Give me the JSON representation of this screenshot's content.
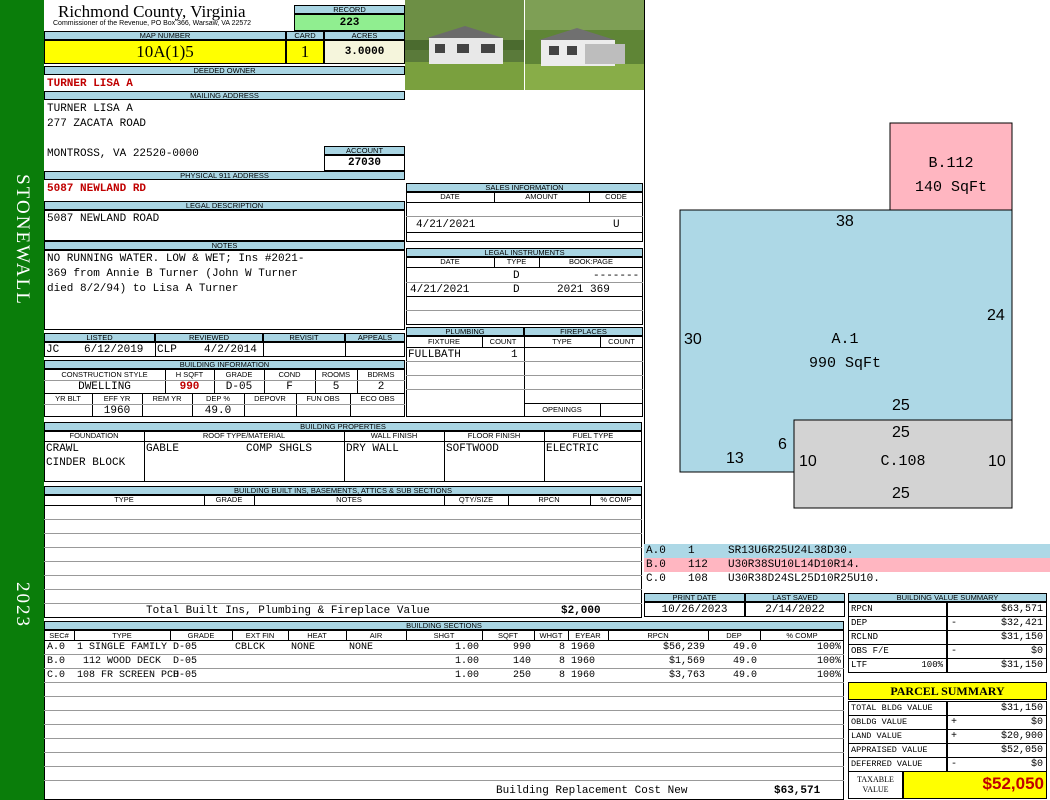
{
  "header": {
    "county": "Richmond County, Virginia",
    "commissioner": "Commissioner of the Revenue, PO Box 366, Warsaw, VA 22572",
    "record_label": "RECORD",
    "record": "223",
    "map_label": "MAP NUMBER",
    "map": "10A(1)5",
    "card_label": "CARD",
    "card": "1",
    "acres_label": "ACRES",
    "acres": "3.0000"
  },
  "sidebar": {
    "district": "STONEWALL",
    "year": "2023",
    "color": "#0a7d0a"
  },
  "owner": {
    "deeded_label": "DEEDED OWNER",
    "deeded": "TURNER LISA A",
    "mailing_label": "MAILING ADDRESS",
    "mail1": "TURNER LISA A",
    "mail2": "277 ZACATA ROAD",
    "mail3": "MONTROSS, VA 22520-0000",
    "account_label": "ACCOUNT",
    "account": "27030",
    "phys_label": "PHYSICAL 911 ADDRESS",
    "phys": "5087 NEWLAND RD",
    "legal_label": "LEGAL DESCRIPTION",
    "legal": "5087 NEWLAND ROAD",
    "notes_label": "NOTES",
    "notes1": "NO RUNNING WATER. LOW & WET; Ins #2021-",
    "notes2": "369 from Annie B Turner (John W Turner",
    "notes3": "died 8/2/94) to Lisa A Turner"
  },
  "sales": {
    "title": "SALES INFORMATION",
    "h_date": "DATE",
    "h_amount": "AMOUNT",
    "h_code": "CODE",
    "date": "4/21/2021",
    "code": "U"
  },
  "legal_instr": {
    "title": "LEGAL INSTRUMENTS",
    "h_date": "DATE",
    "h_type": "TYPE",
    "h_book": "BOOK:PAGE",
    "r1_type": "D",
    "r1_book": "-------",
    "r2_date": "4/21/2021",
    "r2_type": "D",
    "r2_book": "2021 369"
  },
  "review": {
    "h_listed": "LISTED",
    "h_reviewed": "REVIEWED",
    "h_revisit": "REVISIT",
    "h_appeals": "APPEALS",
    "listed_by": "JC",
    "listed_date": "6/12/2019",
    "rev_by": "CLP",
    "rev_date": "4/2/2014"
  },
  "building_info": {
    "title": "BUILDING INFORMATION",
    "h_style": "CONSTRUCTION STYLE",
    "h_hsqft": "H SQFT",
    "h_grade": "GRADE",
    "h_cond": "COND",
    "h_rooms": "ROOMS",
    "h_bdrms": "BDRMS",
    "style": "DWELLING",
    "hsqft": "990",
    "grade": "D-05",
    "cond": "F",
    "rooms": "5",
    "bdrms": "2",
    "h_yrblt": "YR BLT",
    "h_effyr": "EFF YR",
    "h_remyr": "REM YR",
    "h_dep": "DEP %",
    "h_depovr": "DEPOVR",
    "h_funobs": "FUN OBS",
    "h_ecoobs": "ECO OBS",
    "effyr": "1960",
    "dep": "49.0"
  },
  "plumbing": {
    "title": "PLUMBING",
    "h_fixture": "FIXTURE",
    "h_count": "COUNT",
    "fixture": "FULLBATH",
    "count": "1"
  },
  "fireplaces": {
    "title": "FIREPLACES",
    "h_type": "TYPE",
    "h_count": "COUNT",
    "openings": "OPENINGS"
  },
  "props": {
    "title": "BUILDING PROPERTIES",
    "h_found": "FOUNDATION",
    "h_roof": "ROOF TYPE/MATERIAL",
    "h_wall": "WALL FINISH",
    "h_floor": "FLOOR FINISH",
    "h_fuel": "FUEL TYPE",
    "found1": "CRAWL",
    "found2": "CINDER BLOCK",
    "roof1": "GABLE",
    "roof2": "COMP SHGLS",
    "wall": "DRY WALL",
    "floor": "SOFTWOOD",
    "fuel": "ELECTRIC"
  },
  "builtins": {
    "title": "BUILDING BUILT INS, BASEMENTS, ATTICS & SUB SECTIONS",
    "h_type": "TYPE",
    "h_grade": "GRADE",
    "h_notes": "NOTES",
    "h_qty": "QTY/SIZE",
    "h_rpcn": "RPCN",
    "h_comp": "% COMP",
    "total_label": "Total Built Ins, Plumbing & Fireplace Value",
    "total": "$2,000"
  },
  "dates": {
    "h_print": "PRINT DATE",
    "h_saved": "LAST SAVED",
    "print": "10/26/2023",
    "saved": "2/14/2022"
  },
  "sketch": {
    "b_label": "B.112",
    "b_area": "140 SqFt",
    "a_label": "A.1",
    "a_area": "990 SqFt",
    "c_label": "C.108",
    "dims": {
      "a_top": "38",
      "a_left": "30",
      "a_right": "24",
      "a_bottom": "25",
      "a_small": "6",
      "a_bot_left": "13",
      "c_top": "25",
      "c_left": "10",
      "c_right": "10",
      "c_bottom": "25"
    },
    "legend": [
      {
        "code": "A.0",
        "num": "1",
        "desc": "SR13U6R25U24L38D30."
      },
      {
        "code": "B.0",
        "num": "112",
        "desc": "U30R38SU10L14D10R14."
      },
      {
        "code": "C.0",
        "num": "108",
        "desc": "U30R38D24SL25D10R25U10."
      }
    ],
    "colors": {
      "a": "#add8e6",
      "b": "#ffb6c1",
      "c": "#d3d3d3"
    }
  },
  "sections": {
    "title": "BUILDING SECTIONS",
    "headers": [
      "SEC#",
      "TYPE",
      "GRADE",
      "EXT FIN",
      "HEAT",
      "AIR",
      "SHGT",
      "SQFT",
      "WHGT",
      "EYEAR",
      "RPCN",
      "DEP",
      "% COMP"
    ],
    "rows": [
      [
        "A.0",
        "1 SINGLE FAMILY",
        "D-05",
        "CBLCK",
        "NONE",
        "NONE",
        "1.00",
        "990",
        "8",
        "1960",
        "$56,239",
        "49.0",
        "100%"
      ],
      [
        "B.0",
        "112 WOOD DECK",
        "D-05",
        "",
        "",
        "",
        "1.00",
        "140",
        "8",
        "1960",
        "$1,569",
        "49.0",
        "100%"
      ],
      [
        "C.0",
        "108 FR SCREEN PCH",
        "D-05",
        "",
        "",
        "",
        "1.00",
        "250",
        "8",
        "1960",
        "$3,763",
        "49.0",
        "100%"
      ]
    ],
    "rcn_label": "Building Replacement Cost New",
    "rcn": "$63,571"
  },
  "bvs": {
    "title": "BUILDING VALUE SUMMARY",
    "rows": [
      {
        "l": "RPCN",
        "s": "",
        "v": "$63,571"
      },
      {
        "l": "DEP",
        "s": "-",
        "v": "$32,421"
      },
      {
        "l": "RCLND",
        "s": "",
        "v": "$31,150"
      },
      {
        "l": "OBS F/E",
        "s": "-",
        "v": "$0"
      },
      {
        "l": "LTF",
        "p": "100%",
        "s": "",
        "v": "$31,150"
      }
    ]
  },
  "parcel": {
    "title": "PARCEL SUMMARY",
    "rows": [
      {
        "l": "TOTAL BLDG VALUE",
        "s": "",
        "v": "$31,150"
      },
      {
        "l": "OBLDG VALUE",
        "s": "+",
        "v": "$0"
      },
      {
        "l": "LAND VALUE",
        "s": "+",
        "v": "$20,900"
      },
      {
        "l": "APPRAISED VALUE",
        "s": "",
        "v": "$52,050"
      },
      {
        "l": "DEFERRED VALUE",
        "s": "-",
        "v": "$0"
      }
    ],
    "taxable_label1": "TAXABLE",
    "taxable_label2": "VALUE",
    "taxable": "$52,050"
  }
}
